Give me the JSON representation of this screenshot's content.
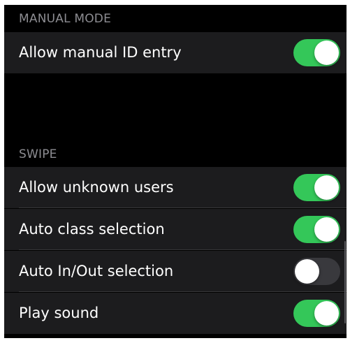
{
  "colors": {
    "background": "#000000",
    "row_background": "#1c1c1e",
    "section_header_text": "#8d8d92",
    "label_text": "#ffffff",
    "toggle_on": "#34c759",
    "toggle_off": "#39393d"
  },
  "sections": [
    {
      "header": "MANUAL MODE",
      "rows": [
        {
          "label": "Allow manual ID entry",
          "toggle_on": true
        }
      ]
    },
    {
      "header": "SWIPE",
      "rows": [
        {
          "label": "Allow unknown users",
          "toggle_on": true
        },
        {
          "label": "Auto class selection",
          "toggle_on": true
        },
        {
          "label": "Auto In/Out selection",
          "toggle_on": false
        },
        {
          "label": "Play sound",
          "toggle_on": true
        }
      ]
    }
  ]
}
